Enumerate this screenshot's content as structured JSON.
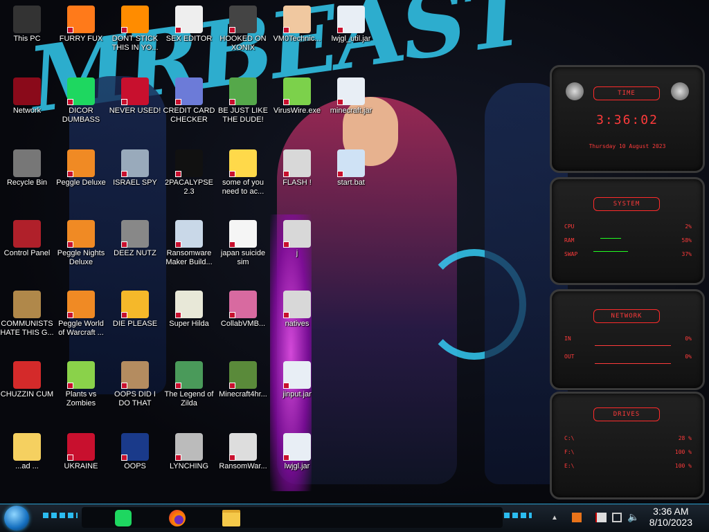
{
  "wallpaper": {
    "brand_text": "MRBEAST"
  },
  "desktop_icons": [
    {
      "label": "This PC",
      "glyph": "pc-icon"
    },
    {
      "label": "FURRY FUX",
      "glyph": "firefox-icon"
    },
    {
      "label": "DONT STICK THIS IN YO...",
      "glyph": "vlc-icon"
    },
    {
      "label": "SEX EDITOR",
      "glyph": "hex-editor-icon"
    },
    {
      "label": "HOOKED ON XONIX",
      "glyph": "xonix-icon"
    },
    {
      "label": "VM0Technic...",
      "glyph": "doctor-icon"
    },
    {
      "label": "lwjgl_util.jar",
      "glyph": "java-icon"
    },
    {
      "label": "Network",
      "glyph": "network-icon"
    },
    {
      "label": "DICOR DUMBASS",
      "glyph": "spotify-icon"
    },
    {
      "label": "NEVER USED!",
      "glyph": "dev-icon"
    },
    {
      "label": "CREDIT CARD CHECKER",
      "glyph": "card-icon"
    },
    {
      "label": "BE JUST LIKE THE DUDE!",
      "glyph": "elf-icon"
    },
    {
      "label": "VirusWire.exe",
      "glyph": "lime-icon"
    },
    {
      "label": "minecraft.jar",
      "glyph": "java-icon"
    },
    {
      "label": "Recycle Bin",
      "glyph": "recycle-bin-icon"
    },
    {
      "label": "Peggle Deluxe",
      "glyph": "peggle-icon"
    },
    {
      "label": "ISRAEL SPY",
      "glyph": "spy-icon"
    },
    {
      "label": "2PACALYPSE 2.3",
      "glyph": "cmd-icon"
    },
    {
      "label": "some of you need to ac...",
      "glyph": "beaver-icon"
    },
    {
      "label": "FLASH !",
      "glyph": "folder-icon"
    },
    {
      "label": "start.bat",
      "glyph": "gear-file-icon"
    },
    {
      "label": "Control Panel",
      "glyph": "control-panel-icon"
    },
    {
      "label": "Peggle Nights Deluxe",
      "glyph": "peggle-icon"
    },
    {
      "label": "DEEZ NUTZ",
      "glyph": "windows-stack-icon"
    },
    {
      "label": "Ransomware Maker Build...",
      "glyph": "window-icon"
    },
    {
      "label": "japan suicide sim",
      "glyph": "document-icon"
    },
    {
      "label": "j",
      "glyph": "folder-icon"
    },
    {
      "label": "COMMUNISTS HATE THIS G...",
      "glyph": "money-bag-icon"
    },
    {
      "label": "Peggle World of Warcraft ...",
      "glyph": "peggle-icon"
    },
    {
      "label": "DIE PLEASE",
      "glyph": "de-icon"
    },
    {
      "label": "Super Hilda",
      "glyph": "pixel-cat-icon"
    },
    {
      "label": "CollabVMB...",
      "glyph": "slides-icon"
    },
    {
      "label": "natives",
      "glyph": "folder-icon"
    },
    {
      "label": "CHUZZIN CUM",
      "glyph": "chuzzle-icon"
    },
    {
      "label": "Plants vs Zombies",
      "glyph": "pvz-icon"
    },
    {
      "label": "OOPS DID I DO THAT",
      "glyph": "portrait-icon"
    },
    {
      "label": "The Legend of Zilda",
      "glyph": "link-icon"
    },
    {
      "label": "Minecraft4hr...",
      "glyph": "grass-block-icon"
    },
    {
      "label": "jinput.jar",
      "glyph": "java-icon"
    },
    {
      "label": "...ad ...",
      "glyph": "cartoon-icon"
    },
    {
      "label": "UKRAINE",
      "glyph": "radiation-icon"
    },
    {
      "label": "OOPS",
      "glyph": "bsod-icon"
    },
    {
      "label": "LYNCHING",
      "glyph": "noose-icon"
    },
    {
      "label": "RansomWar...",
      "glyph": "skull-icon"
    },
    {
      "label": "lwjgl.jar",
      "glyph": "java-icon"
    }
  ],
  "widgets": {
    "time": {
      "title": "TIME",
      "clock": "3:36:02",
      "date": "Thursday 10 August 2023"
    },
    "system": {
      "title": "SYSTEM",
      "rows": [
        {
          "label": "CPU",
          "value": "2%"
        },
        {
          "label": "RAM",
          "value": "58%"
        },
        {
          "label": "SWAP",
          "value": "37%"
        }
      ]
    },
    "network": {
      "title": "NETWORK",
      "rows": [
        {
          "label": "IN",
          "value": "0%"
        },
        {
          "label": "OUT",
          "value": "0%"
        }
      ]
    },
    "drives": {
      "title": "DRIVES",
      "rows": [
        {
          "label": "C:\\",
          "value": "28 %"
        },
        {
          "label": "F:\\",
          "value": "100 %"
        },
        {
          "label": "E:\\",
          "value": "100 %"
        }
      ]
    }
  },
  "taskbar": {
    "start": "start-orb",
    "pinned": [
      {
        "name": "spotify-taskbar-icon"
      },
      {
        "name": "firefox-taskbar-icon"
      },
      {
        "name": "explorer-taskbar-icon"
      }
    ],
    "clock_time": "3:36 AM",
    "clock_date": "8/10/2023"
  }
}
